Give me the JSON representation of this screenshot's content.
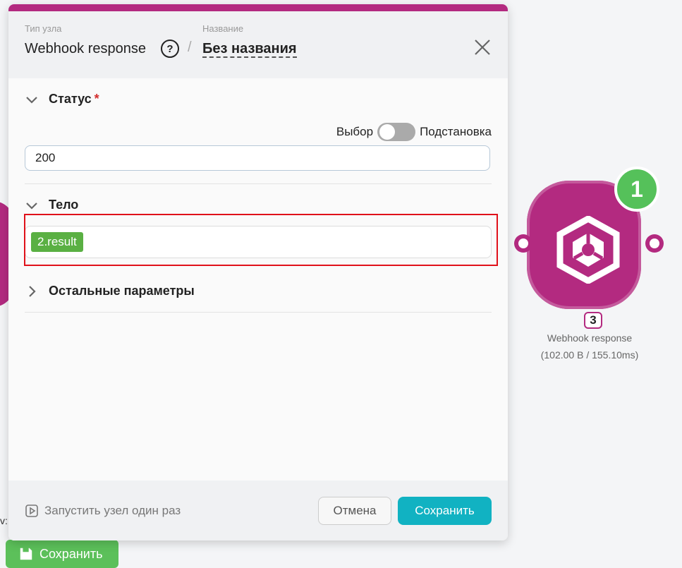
{
  "header": {
    "type_label": "Тип узла",
    "type_value": "Webhook response",
    "name_label": "Название",
    "name_value": "Без названия"
  },
  "status": {
    "title": "Статус",
    "required_mark": "*",
    "toggle_left": "Выбор",
    "toggle_right": "Подстановка",
    "value": "200"
  },
  "body": {
    "title": "Тело",
    "chip": "2.result"
  },
  "other_params": {
    "title": "Остальные параметры"
  },
  "footer": {
    "run_once": "Запустить узел один раз",
    "cancel": "Отмена",
    "save": "Сохранить"
  },
  "node": {
    "badge": "1",
    "number": "3",
    "title": "Webhook response",
    "stats": "(102.00 B / 155.10ms)"
  },
  "background": {
    "cut_text": "v:",
    "save_button": "Сохранить"
  },
  "colors": {
    "brand": "#b32a80",
    "save": "#11b2c2",
    "chip": "#5ab043",
    "badge": "#55c15a",
    "highlight": "#e0111a"
  }
}
